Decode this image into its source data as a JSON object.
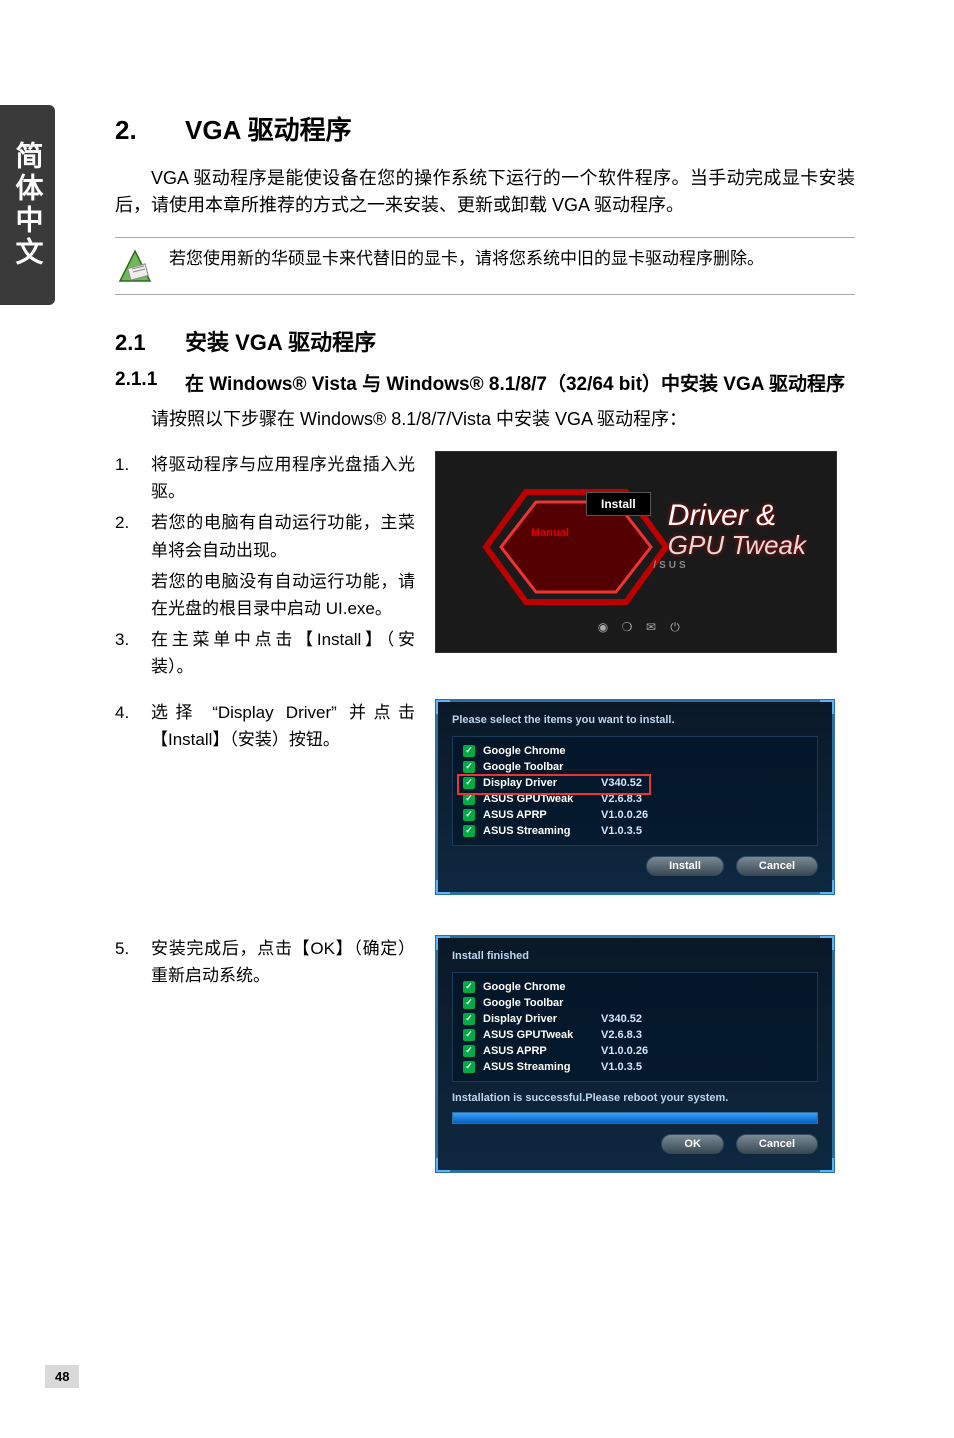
{
  "side_tab": "简体中文",
  "page_number": "48",
  "heading": {
    "num": "2.",
    "title": "VGA 驱动程序"
  },
  "intro": "VGA 驱动程序是能使设备在您的操作系统下运行的一个软件程序。当手动完成显卡安装后，请使用本章所推荐的方式之一来安装、更新或卸载 VGA 驱动程序。",
  "note": "若您使用新的华硕显卡来代替旧的显卡，请将您系统中旧的显卡驱动程序删除。",
  "h2": {
    "num": "2.1",
    "title": "安装 VGA 驱动程序"
  },
  "h3": {
    "num": "2.1.1",
    "title": "在 Windows® Vista 与 Windows® 8.1/8/7（32/64 bit）中安装 VGA 驱动程序"
  },
  "sub_intro": "请按照以下步骤在 Windows® 8.1/8/7/Vista 中安装 VGA 驱动程序：",
  "steps": [
    {
      "n": "1.",
      "t": "将驱动程序与应用程序光盘插入光驱。"
    },
    {
      "n": "2.",
      "t": "若您的电脑有自动运行功能，主菜单将会自动出现。",
      "sub": "若您的电脑没有自动运行功能，请在光盘的根目录中启动 UI.exe。"
    },
    {
      "n": "3.",
      "t": "在主菜单中点击【Install】（安装）。"
    },
    {
      "n": "4.",
      "t": "选择 “Display Driver” 并点击【Install】（安装）按钮。"
    },
    {
      "n": "5.",
      "t": "安装完成后，点击【OK】（确定）重新启动系统。"
    }
  ],
  "shot1": {
    "install": "Install",
    "manual": "Manual",
    "logo_l1": "Driver &",
    "logo_l2": "GPU Tweak",
    "brand": "/SUS"
  },
  "shot2": {
    "title": "Please select the items you want to install.",
    "items": [
      {
        "name": "Google Chrome",
        "ver": ""
      },
      {
        "name": "Google Toolbar",
        "ver": ""
      },
      {
        "name": "Display Driver",
        "ver": "V340.52",
        "highlight": true
      },
      {
        "name": "ASUS GPUTweak",
        "ver": "V2.6.8.3"
      },
      {
        "name": "ASUS APRP",
        "ver": "V1.0.0.26"
      },
      {
        "name": "ASUS Streaming",
        "ver": "V1.0.3.5"
      }
    ],
    "btn_install": "Install",
    "btn_cancel": "Cancel"
  },
  "shot3": {
    "title": "Install finished",
    "items": [
      {
        "name": "Google Chrome",
        "ver": ""
      },
      {
        "name": "Google Toolbar",
        "ver": ""
      },
      {
        "name": "Display Driver",
        "ver": "V340.52"
      },
      {
        "name": "ASUS GPUTweak",
        "ver": "V2.6.8.3"
      },
      {
        "name": "ASUS APRP",
        "ver": "V1.0.0.26"
      },
      {
        "name": "ASUS Streaming",
        "ver": "V1.0.3.5"
      }
    ],
    "msg": "Installation is successful.Please reboot your system.",
    "btn_ok": "OK",
    "btn_cancel": "Cancel"
  }
}
